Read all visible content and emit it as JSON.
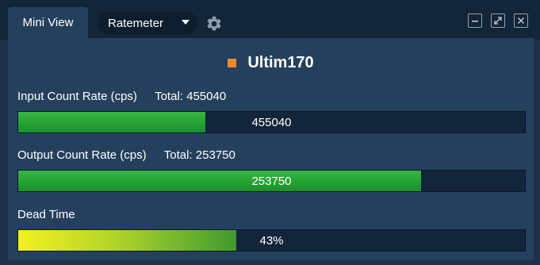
{
  "header": {
    "tab_label": "Mini View",
    "mode_select": "Ratemeter",
    "gear_icon": "gear-icon",
    "window_buttons": [
      "minimize-icon",
      "maximize-icon",
      "close-icon"
    ]
  },
  "device": {
    "name": "Ultim170",
    "indicator_color": "#f0892b"
  },
  "meters": {
    "input": {
      "label": "Input Count Rate (cps)",
      "total_label": "Total:",
      "total_value": "455040",
      "bar_text": "455040",
      "fill_fraction": 0.37,
      "color": "#2aa83a"
    },
    "output": {
      "label": "Output Count Rate (cps)",
      "total_label": "Total:",
      "total_value": "253750",
      "bar_text": "253750",
      "fill_fraction": 0.795,
      "color": "#2aa83a"
    },
    "dead_time": {
      "label": "Dead Time",
      "bar_text": "43%",
      "fill_fraction": 0.43,
      "color": "#f4f01e"
    }
  },
  "colors": {
    "panel_bg": "#1c3149",
    "content_bg": "#25405d",
    "bar_track": "#13253a"
  }
}
